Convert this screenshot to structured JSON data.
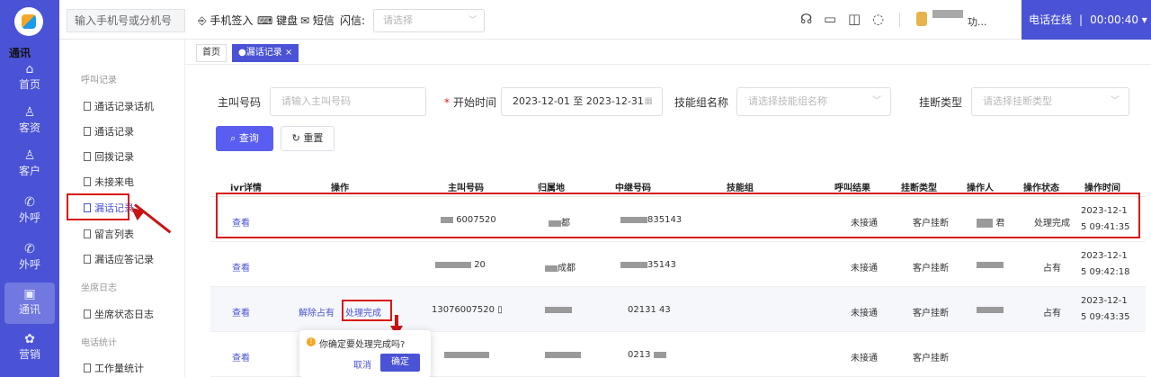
{
  "rail": {
    "items": [
      {
        "label": "首页",
        "icon": "home-icon",
        "glyph": "⌂"
      },
      {
        "label": "客资",
        "icon": "users-icon",
        "glyph": "♙"
      },
      {
        "label": "客户",
        "icon": "user-icon",
        "glyph": "♙"
      },
      {
        "label": "外呼",
        "icon": "phone-out-icon",
        "glyph": "✆"
      },
      {
        "label": "外呼",
        "icon": "phone-out-icon",
        "glyph": "✆"
      },
      {
        "label": "通讯",
        "icon": "comm-icon",
        "glyph": "▣"
      },
      {
        "label": "营销",
        "icon": "marketing-icon",
        "glyph": "✿"
      }
    ]
  },
  "topbar": {
    "phone_placeholder": "输入手机号或分机号",
    "sign_in": "手机签入",
    "keyboard": "键盘",
    "sms": "短信",
    "flash_label": "闪信:",
    "flash_placeholder": "请选择",
    "user_text": "功...",
    "status": "电话在线",
    "timer": "00:00:40"
  },
  "subnav": {
    "title": "通讯",
    "groups": [
      {
        "label": "呼叫记录"
      },
      {
        "label": "坐席日志"
      },
      {
        "label": "电话统计"
      }
    ],
    "items": [
      {
        "label": "通话记录话机"
      },
      {
        "label": "通话记录"
      },
      {
        "label": "回拨记录"
      },
      {
        "label": "未接来电"
      },
      {
        "label": "漏话记录"
      },
      {
        "label": "留言列表"
      },
      {
        "label": "漏话应答记录"
      },
      {
        "label": "坐席状态日志"
      },
      {
        "label": "工作量统计"
      }
    ]
  },
  "tabs": [
    {
      "label": "首页"
    },
    {
      "label": "●漏话记录 ×"
    }
  ],
  "filters": {
    "caller_label": "主叫号码",
    "caller_placeholder": "请输入主叫号码",
    "start_label": "开始时间",
    "date_range": "2023-12-01 至 2023-12-31",
    "skill_label": "技能组名称",
    "skill_placeholder": "请选择技能组名称",
    "hangup_label": "挂断类型",
    "hangup_placeholder": "请选择挂断类型",
    "query_btn": "查询",
    "reset_btn": "重置"
  },
  "table": {
    "headers": [
      "ivr详情",
      "操作",
      "主叫号码",
      "归属地",
      "中继号码",
      "技能组",
      "呼叫结果",
      "挂断类型",
      "操作人",
      "操作状态",
      "操作时间"
    ],
    "rows": [
      {
        "detail": "查看",
        "op1": "",
        "op2": "",
        "caller": "6007520",
        "region": "都",
        "trunk": "835143",
        "result": "未接通",
        "hangup": "客户挂断",
        "operator": "君",
        "status": "处理完成",
        "time1": "2023-12-1",
        "time2": "5 09:41:35"
      },
      {
        "detail": "查看",
        "op1": "",
        "op2": "",
        "caller": "20",
        "region": "成都",
        "trunk": "35143",
        "result": "未接通",
        "hangup": "客户挂断",
        "operator": "",
        "status": "占有",
        "time1": "2023-12-1",
        "time2": "5 09:42:18"
      },
      {
        "detail": "查看",
        "op1": "解除占有",
        "op2": "处理完成",
        "caller": "13076007520",
        "region": "",
        "trunk": "02131 43",
        "result": "未接通",
        "hangup": "客户挂断",
        "operator": "",
        "status": "占有",
        "time1": "2023-12-1",
        "time2": "5 09:43:35"
      },
      {
        "detail": "查看",
        "op1": "",
        "op2": "",
        "caller": "",
        "region": "",
        "trunk": "0213",
        "result": "未接通",
        "hangup": "客户挂断",
        "operator": "",
        "status": "",
        "time1": "",
        "time2": ""
      }
    ]
  },
  "popover": {
    "message": "你确定要处理完成吗?",
    "cancel": "取消",
    "confirm": "确定"
  }
}
